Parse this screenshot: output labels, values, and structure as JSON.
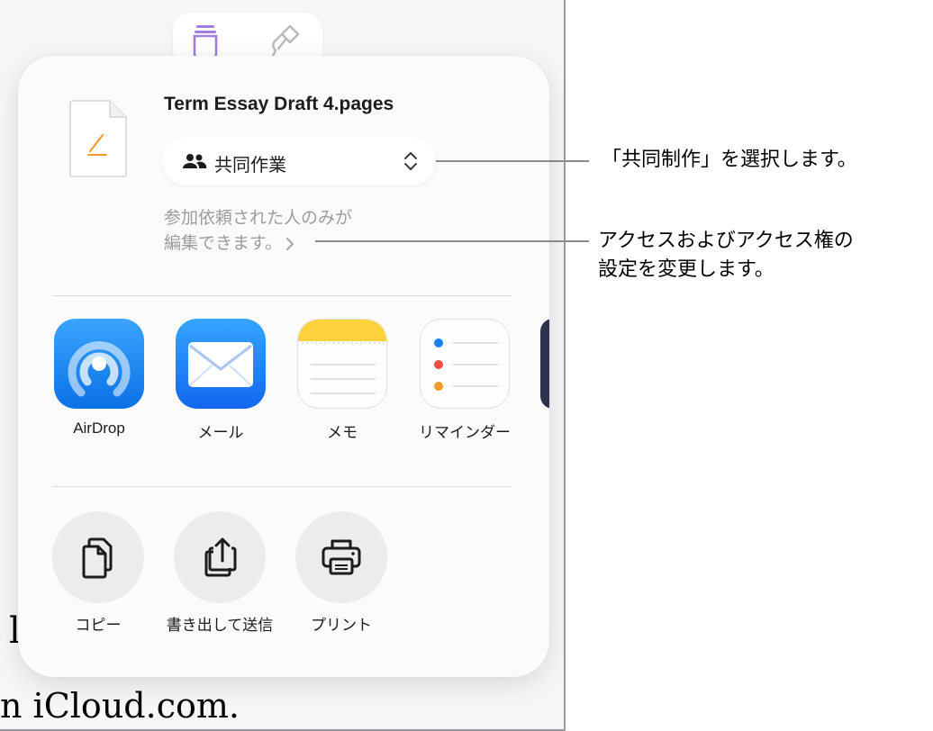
{
  "background": {
    "fragment_1": "l",
    "fragment_2": "n iCloud.com."
  },
  "tabs": {
    "format_icon": "format-icon",
    "brush_icon": "paintbrush-icon"
  },
  "share_sheet": {
    "document_title": "Term Essay Draft 4.pages",
    "collaboration_mode": "共同作業",
    "access_line_1": "参加依頼された人のみが",
    "access_line_2": "編集できます。",
    "apps": [
      {
        "label": "AirDrop"
      },
      {
        "label": "メール"
      },
      {
        "label": "メモ"
      },
      {
        "label": "リマインダー"
      }
    ],
    "actions": [
      {
        "label": "コピー"
      },
      {
        "label": "書き出して送信"
      },
      {
        "label": "プリント"
      }
    ]
  },
  "callouts": {
    "select_collab": "「共同制作」を選択します。",
    "change_access_line_1": "アクセスおよびアクセス権の",
    "change_access_line_2": "設定を変更します。"
  },
  "colors": {
    "accent_purple": "#a47de4",
    "pages_orange": "#f39a2b",
    "notes_yellow": "#fdd23c",
    "airdrop_blue": "#1a86f2"
  }
}
